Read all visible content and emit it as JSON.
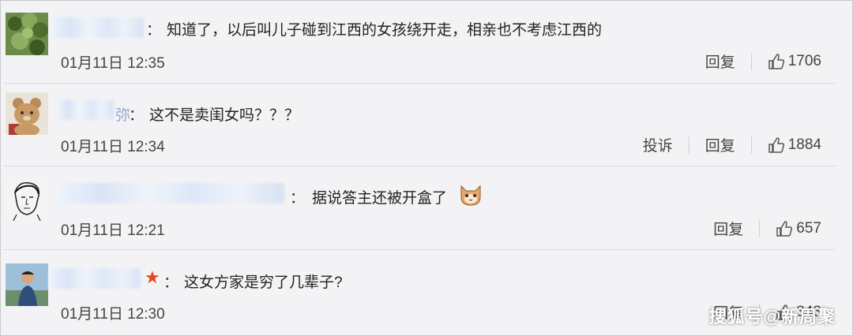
{
  "comments": [
    {
      "text": "知道了，以后叫儿子碰到江西的女孩绕开走，相亲也不考虑江西的",
      "date": "01月11日 12:35",
      "reply_label": "回复",
      "likes": "1706"
    },
    {
      "name_visible": "弥",
      "text": "这不是卖闺女吗？？？",
      "date": "01月11日 12:34",
      "report_label": "投诉",
      "reply_label": "回复",
      "likes": "1884"
    },
    {
      "text": "据说答主还被开盒了",
      "date": "01月11日 12:21",
      "reply_label": "回复",
      "likes": "657"
    },
    {
      "text": "这女方家是穷了几辈子?",
      "date": "01月11日 12:30",
      "reply_label": "回复",
      "likes": "343"
    }
  ],
  "colon": "：",
  "watermark": "搜狐号@新周聚"
}
